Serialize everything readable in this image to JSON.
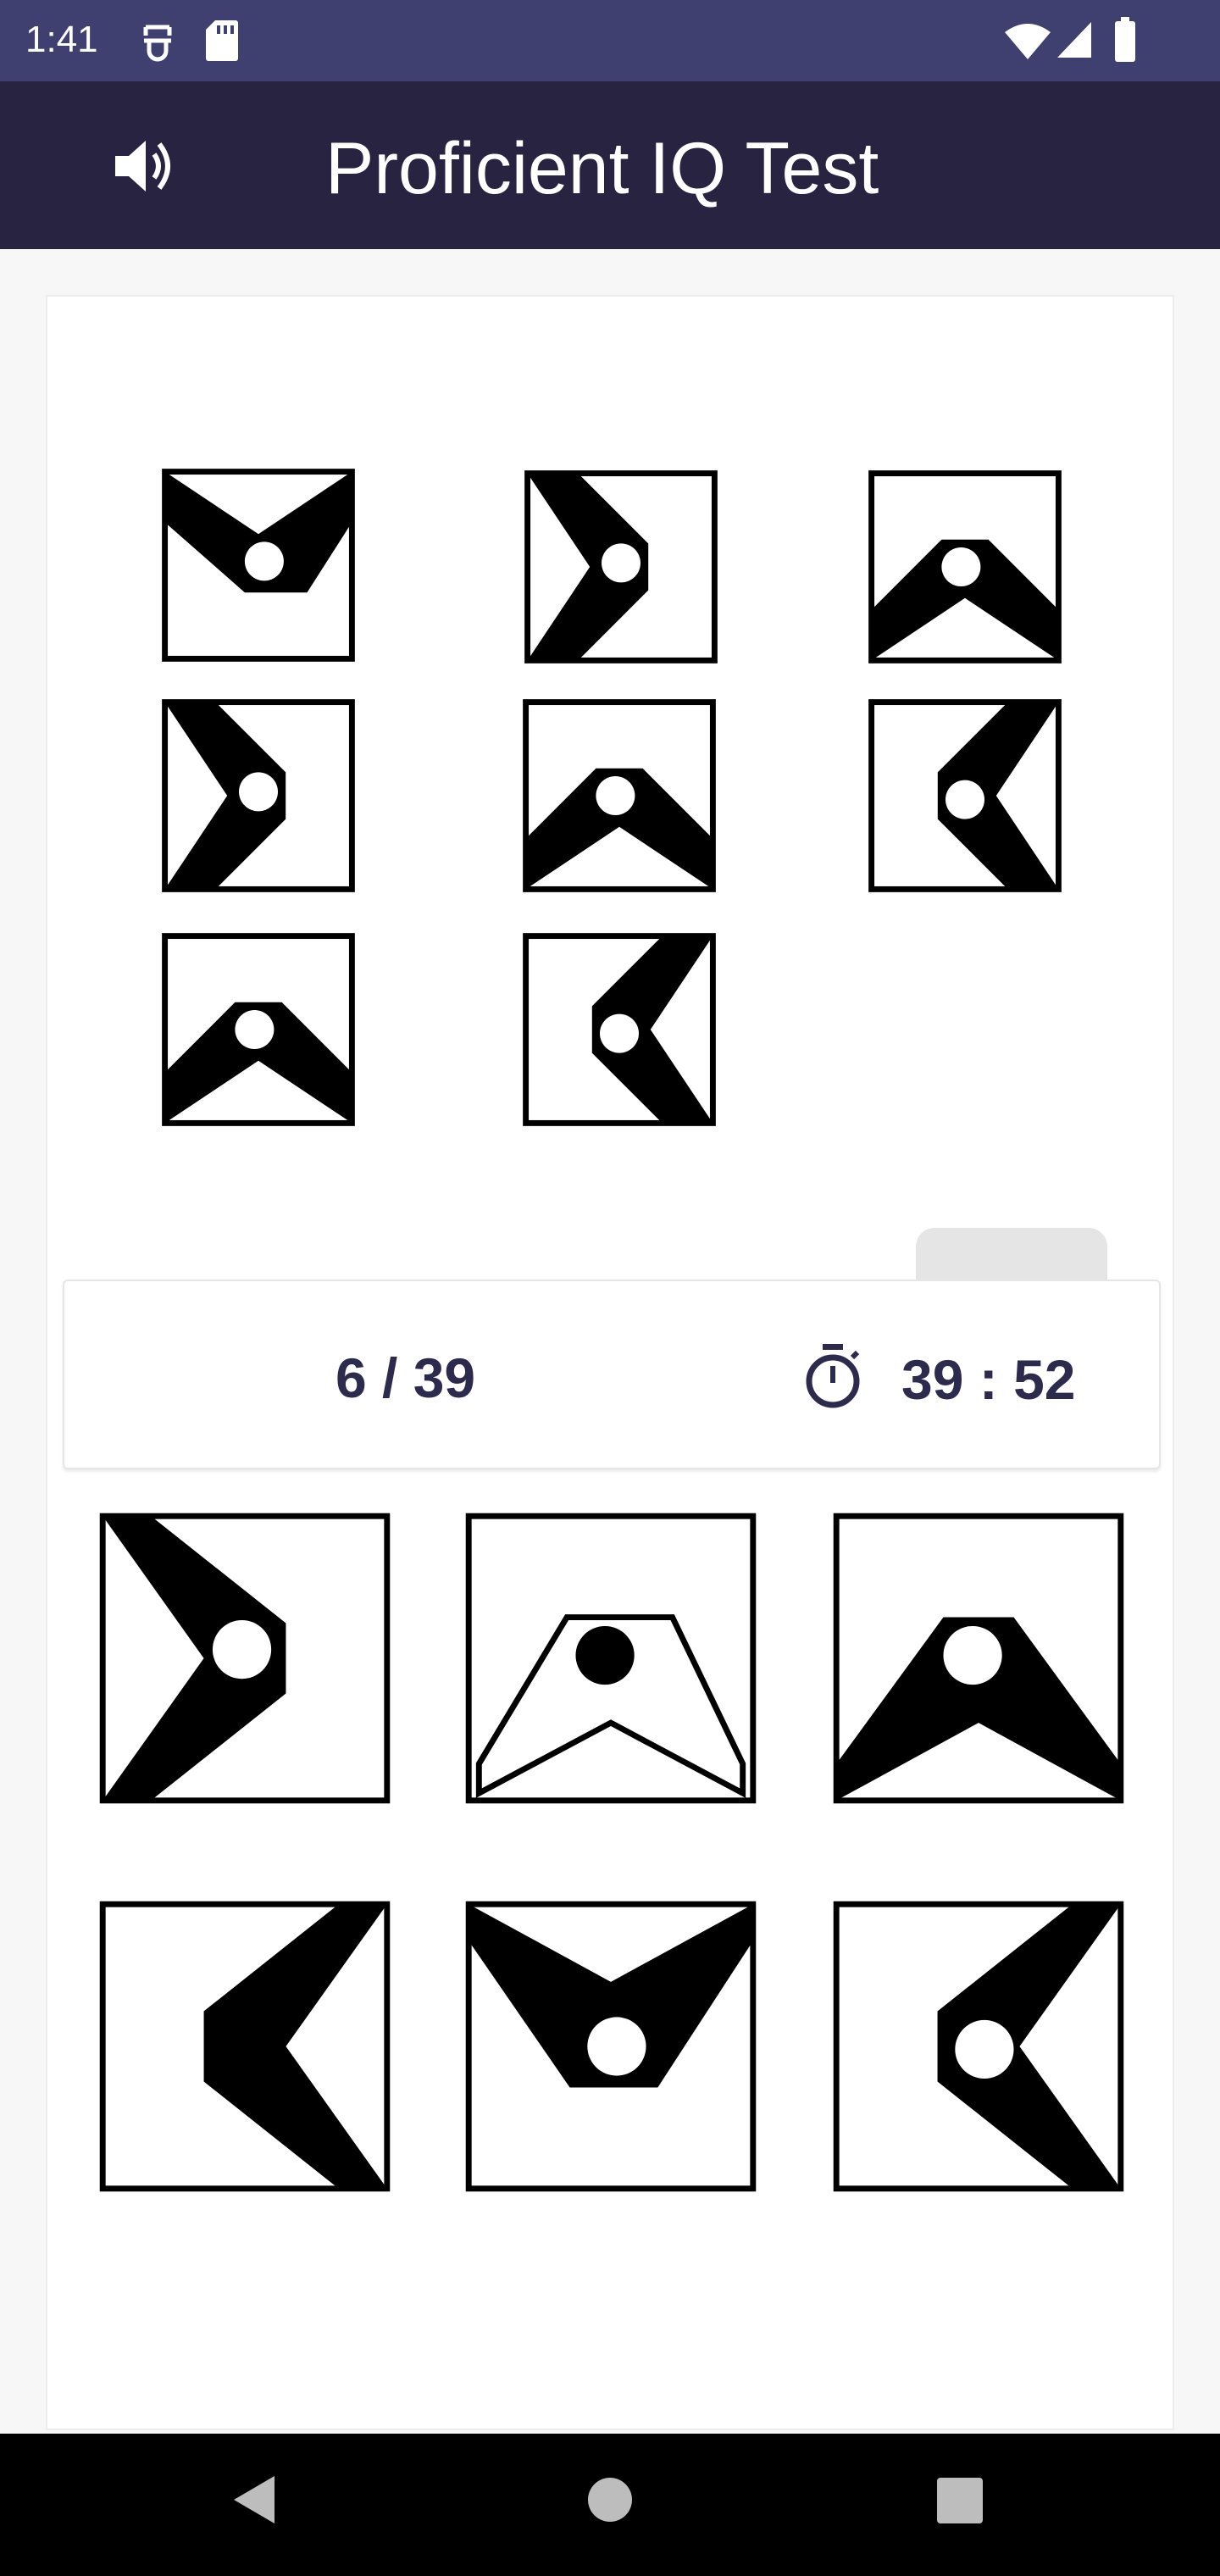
{
  "status_bar": {
    "time": "1:41",
    "left_icons": [
      "assistant-icon",
      "sd-card-icon"
    ],
    "right_icons": [
      "wifi-icon",
      "signal-icon",
      "battery-icon"
    ]
  },
  "app_bar": {
    "title": "Proficient IQ Test",
    "sound_icon": "volume-icon",
    "background": "#282340",
    "status_background": "#3f4070"
  },
  "puzzle": {
    "grid_cells": [
      {
        "row": 1,
        "col": 1,
        "figure": "chevron pointing down, dot in notch"
      },
      {
        "row": 1,
        "col": 2,
        "figure": "chevron pointing right, dot in notch"
      },
      {
        "row": 1,
        "col": 3,
        "figure": "chevron pointing up, dot in notch"
      },
      {
        "row": 2,
        "col": 1,
        "figure": "chevron pointing right, dot in notch"
      },
      {
        "row": 2,
        "col": 2,
        "figure": "chevron pointing up, dot in notch"
      },
      {
        "row": 2,
        "col": 3,
        "figure": "chevron pointing left, dot in notch"
      },
      {
        "row": 3,
        "col": 1,
        "figure": "chevron pointing up, dot in notch"
      },
      {
        "row": 3,
        "col": 2,
        "figure": "chevron pointing left, dot in notch"
      }
    ],
    "missing_label": "?"
  },
  "info": {
    "progress": "6 / 39",
    "timer": "39 : 52",
    "timer_icon": "stopwatch-icon",
    "text_color": "#2c2b4e"
  },
  "answer_options": [
    {
      "index": 1,
      "figure": "solid chevron pointing right, dot in notch"
    },
    {
      "index": 2,
      "figure": "outlined chevron pointing up, black dot"
    },
    {
      "index": 3,
      "figure": "solid chevron pointing up, dot in notch"
    },
    {
      "index": 4,
      "figure": "solid chevron pointing left, no dot"
    },
    {
      "index": 5,
      "figure": "solid chevron pointing down, dot in notch"
    },
    {
      "index": 6,
      "figure": "solid chevron pointing left, dot in notch"
    }
  ],
  "nav_bar": {
    "buttons": [
      "back-icon",
      "home-icon",
      "recents-icon"
    ]
  }
}
